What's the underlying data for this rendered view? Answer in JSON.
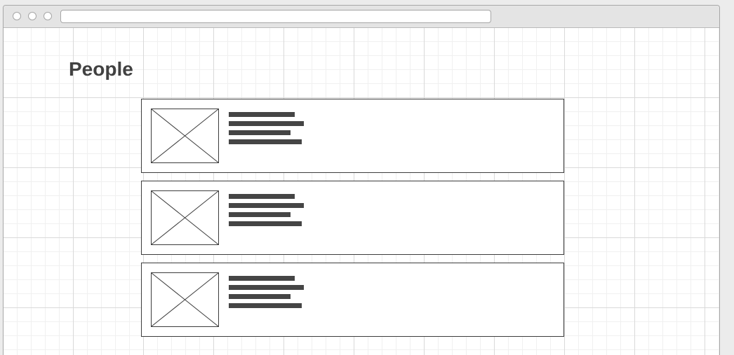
{
  "browser": {
    "address": ""
  },
  "page": {
    "title": "People"
  },
  "people": [
    {
      "image": "image-placeholder-icon"
    },
    {
      "image": "image-placeholder-icon"
    },
    {
      "image": "image-placeholder-icon"
    }
  ],
  "colors": {
    "text": "#414141",
    "border": "#3c3c3c",
    "placeholder_text_bar": "#454545",
    "grid": "#d9d9d9",
    "window_chrome": "#e4e4e4"
  }
}
